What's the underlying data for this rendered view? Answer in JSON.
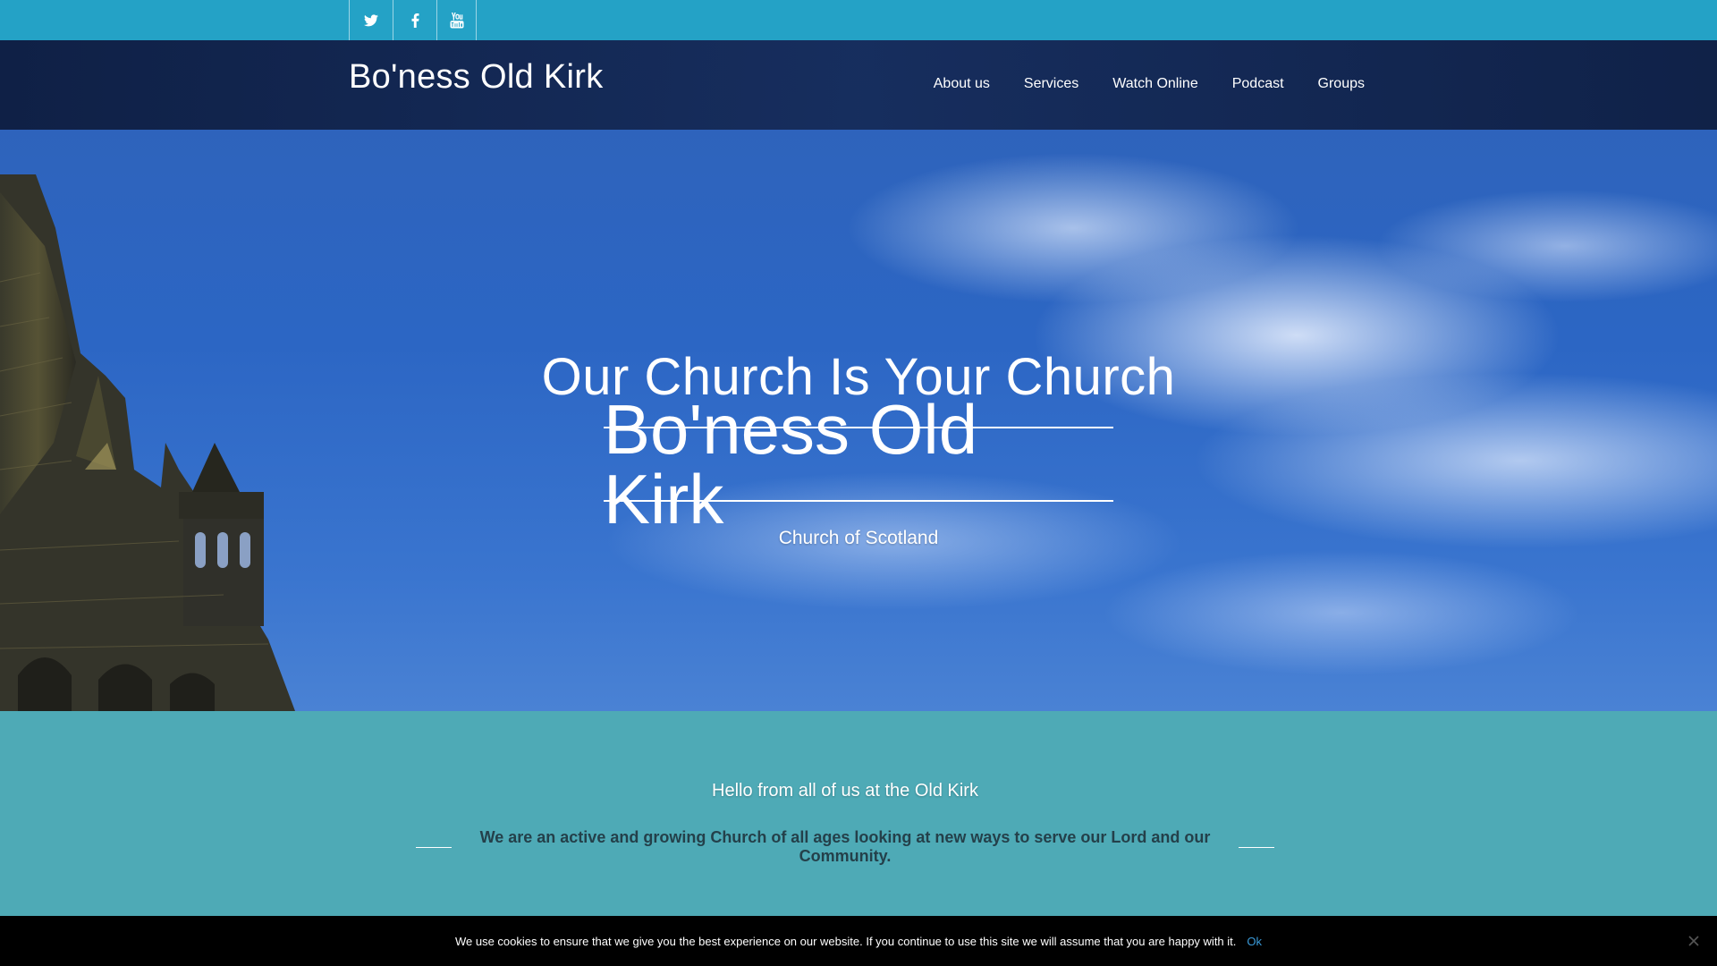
{
  "social": {
    "icons": [
      "twitter-icon",
      "facebook-icon",
      "youtube-icon"
    ]
  },
  "header": {
    "site_title": "Bo'ness Old Kirk",
    "nav": [
      "About us",
      "Services",
      "Watch Online",
      "Podcast",
      "Groups"
    ]
  },
  "hero": {
    "tagline": "Our Church Is Your Church",
    "title": "Bo'ness Old Kirk",
    "subtitle": "Church of Scotland"
  },
  "welcome": {
    "heading": "Hello from all of us at the Old Kirk",
    "mission": "We are an active and growing Church of all ages looking at new ways to serve our Lord and our Community."
  },
  "cookie": {
    "message": "We use cookies to ensure that we give you the best experience on our website. If you continue to use this site we will assume that you are happy with it.",
    "ok_label": "Ok"
  },
  "colors": {
    "topbar": "#24a2c6",
    "nav_band": "#14285a",
    "welcome_bg": "#4eaab6",
    "mission_text": "#24404a",
    "cookie_ok": "#3a9ad9"
  }
}
